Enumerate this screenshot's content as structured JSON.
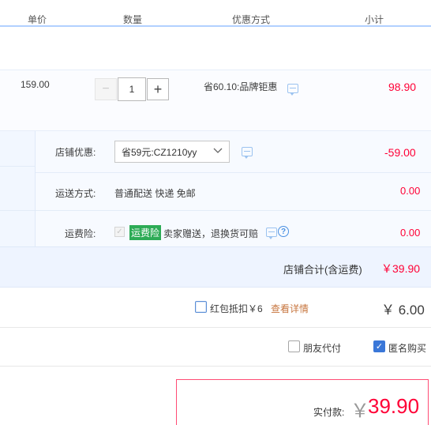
{
  "header": {
    "col_price": "单价",
    "col_quantity": "数量",
    "col_discount": "优惠方式",
    "col_subtotal": "小计"
  },
  "item": {
    "unit_price": "159.00",
    "quantity": "1",
    "minus": "−",
    "plus": "+",
    "discount_text": "省60.10:品牌钜惠",
    "subtotal": "98.90"
  },
  "shop": {
    "coupon_label": "店铺优惠:",
    "coupon_selected": "省59元:CZ1210yy",
    "coupon_amount": "-59.00",
    "shipping_label": "运送方式:",
    "shipping_method": "普通配送 快递 免邮",
    "shipping_amount": "0.00",
    "insurance_label": "运费险:",
    "insurance_tag": "运费险",
    "insurance_text": "卖家赠送，退换货可赔",
    "insurance_amount": "0.00",
    "total_label": "店铺合计(含运费)",
    "total_amount": "￥39.90"
  },
  "red_packet": {
    "label": "红包抵扣￥6",
    "details_link": "查看详情",
    "amount": "￥ 6.00"
  },
  "options": {
    "friend_pay": "朋友代付",
    "anonymous": "匿名购买"
  },
  "payment": {
    "label": "实付款:",
    "currency": "￥",
    "amount": "39.90"
  },
  "colors": {
    "price_red": "#ff0036",
    "link_orange": "#c7763f",
    "accent_blue": "#3a77d8",
    "tag_green": "#2dab56"
  }
}
